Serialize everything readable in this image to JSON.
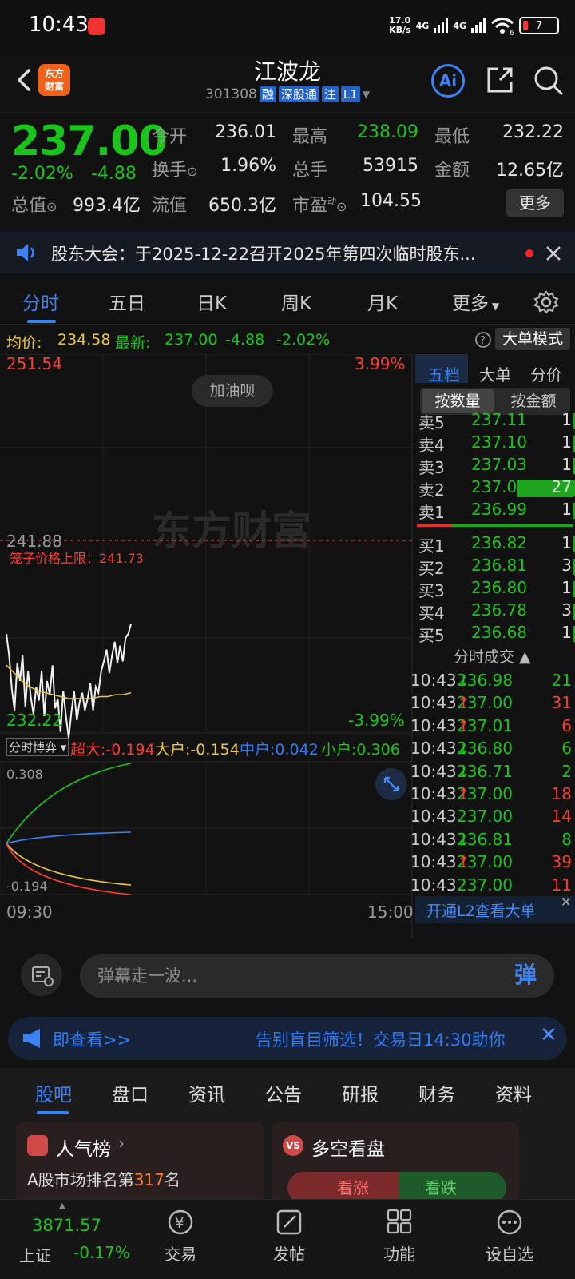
{
  "status_bar": {
    "time": "10:43",
    "net_speed_top": "17.0",
    "net_speed_bottom": "KB/s",
    "sig1": "4G",
    "sig2": "4G",
    "wifi_num": "6",
    "battery": "7"
  },
  "header": {
    "logo_line1": "东方",
    "logo_line2": "财富",
    "stock_name": "江波龙",
    "stock_code": "301308",
    "tags": [
      "融",
      "深股通",
      "注",
      "L1"
    ],
    "ai_label": "Ai"
  },
  "quote": {
    "price": "237.00",
    "pct": "-2.02%",
    "change": "-4.88",
    "open_label": "今开",
    "open": "236.01",
    "high_label": "最高",
    "high": "238.09",
    "low_label": "最低",
    "low": "232.22",
    "turnover_label": "换手",
    "turnover": "1.96%",
    "volume_label": "总手",
    "volume": "53915",
    "amount_label": "金额",
    "amount": "12.65亿",
    "mktcap_label": "总值",
    "mktcap": "993.4亿",
    "float_label": "流值",
    "float": "650.3亿",
    "pe_label": "市盈",
    "pe_sup": "动",
    "pe": "104.55",
    "more_label": "更多"
  },
  "notice": {
    "text": "股东大会：于2025-12-22召开2025年第四次临时股东..."
  },
  "tabs": [
    "分时",
    "五日",
    "日K",
    "周K",
    "月K",
    "更多"
  ],
  "info": {
    "avg_label": "均价:",
    "avg": "234.58",
    "latest_label": "最新:",
    "latest": "237.00",
    "chg": "-4.88",
    "pct": "-2.02%",
    "bigorder_btn": "大单模式"
  },
  "chart": {
    "y_top": "251.54",
    "y_top_pct": "3.99%",
    "y_mid": "241.88",
    "y_bottom": "232.22",
    "y_bottom_pct": "-3.99%",
    "bubble": "加油呗",
    "cage_label": "笼子价格上限：241.73",
    "watermark": "东方财富",
    "x_start": "09:30",
    "x_end": "15:00"
  },
  "chart_data": {
    "type": "line",
    "series": [
      {
        "values": [
          237.6,
          236.5,
          234.8,
          233.7,
          236.1,
          235.2,
          236.5,
          233.9,
          235.7,
          234.4,
          233.5,
          234.9,
          234.2,
          235.7,
          233.4,
          235.2,
          234.5,
          236.0,
          233.8,
          234.3,
          232.6,
          234.7,
          233.4,
          232.3,
          233.6,
          234.7,
          233.2,
          234.1,
          234.6,
          233.7,
          234.3,
          235.1,
          233.7,
          234.9,
          234.6,
          235.7,
          236.2,
          236.8,
          235.6,
          236.5,
          237.2,
          236.1,
          237.0,
          236.2,
          237.4,
          237.6,
          238.1
        ]
      },
      {
        "values": [
          236.0,
          235.6,
          235.2,
          234.9,
          234.7,
          234.6,
          234.5,
          234.4,
          234.3,
          234.3,
          234.3,
          234.3,
          234.4,
          234.4,
          234.5,
          234.5,
          234.6
        ]
      }
    ],
    "ylim": [
      232.22,
      251.54
    ]
  },
  "flow": {
    "select_label": "分时博弈",
    "super_label": "超大:",
    "super": "-0.194",
    "big_label": "大户:",
    "big": "-0.154",
    "mid_label": "中户:",
    "mid": "0.042",
    "small_label": "小户:",
    "small": "0.306",
    "y_top": "0.308",
    "y_bottom": "-0.194"
  },
  "orderbook": {
    "tabs": [
      "五档",
      "大单",
      "分价"
    ],
    "mode_tabs": [
      "按数量",
      "按金额"
    ],
    "asks": [
      {
        "label": "卖5",
        "price": "237.11",
        "qty": "1"
      },
      {
        "label": "卖4",
        "price": "237.10",
        "qty": "1"
      },
      {
        "label": "卖3",
        "price": "237.03",
        "qty": "1"
      },
      {
        "label": "卖2",
        "price": "237.00",
        "qty": "27"
      },
      {
        "label": "卖1",
        "price": "236.99",
        "qty": "1"
      }
    ],
    "bids": [
      {
        "label": "买1",
        "price": "236.82",
        "qty": "1"
      },
      {
        "label": "买2",
        "price": "236.81",
        "qty": "3"
      },
      {
        "label": "买3",
        "price": "236.80",
        "qty": "1"
      },
      {
        "label": "买4",
        "price": "236.78",
        "qty": "3"
      },
      {
        "label": "买5",
        "price": "236.68",
        "qty": "1"
      }
    ],
    "trades_title": "分时成交",
    "trades": [
      {
        "time": "10:43",
        "price": "236.98",
        "dir": "↓",
        "qty": "21"
      },
      {
        "time": "10:43",
        "price": "237.00",
        "dir": "↑",
        "qty": "31"
      },
      {
        "time": "10:43",
        "price": "237.01",
        "dir": "↑",
        "qty": "6"
      },
      {
        "time": "10:43",
        "price": "236.80",
        "dir": "↓",
        "qty": "6"
      },
      {
        "time": "10:43",
        "price": "236.71",
        "dir": "↓",
        "qty": "2"
      },
      {
        "time": "10:43",
        "price": "237.00",
        "dir": "↑",
        "qty": "18"
      },
      {
        "time": "10:43",
        "price": "237.00",
        "dir": "",
        "qty": "14"
      },
      {
        "time": "10:43",
        "price": "236.81",
        "dir": "↓",
        "qty": "8"
      },
      {
        "time": "10:43",
        "price": "237.00",
        "dir": "↑",
        "qty": "39"
      },
      {
        "time": "10:43",
        "price": "237.00",
        "dir": "",
        "qty": "11"
      }
    ],
    "l2_link": "开通L2查看大单"
  },
  "danmu": {
    "placeholder": "弹幕走一波...",
    "btn": "弹"
  },
  "adbar": {
    "left": "即查看>>",
    "right": "告别盲目筛选！交易日14:30助你"
  },
  "subtabs": [
    "股吧",
    "盘口",
    "资讯",
    "公告",
    "研报",
    "财务",
    "资料"
  ],
  "cards": {
    "left_title": "人气榜",
    "left_text": "A股市场排名第",
    "left_rank": "317",
    "left_suffix": "名",
    "right_title": "多空看盘",
    "right_up": "看涨",
    "right_down": "看跌"
  },
  "bottomnav": {
    "index_value": "3871.57",
    "index_name": "上证",
    "index_pct": "-0.17%",
    "items": [
      "交易",
      "发帖",
      "功能",
      "设自选"
    ]
  }
}
